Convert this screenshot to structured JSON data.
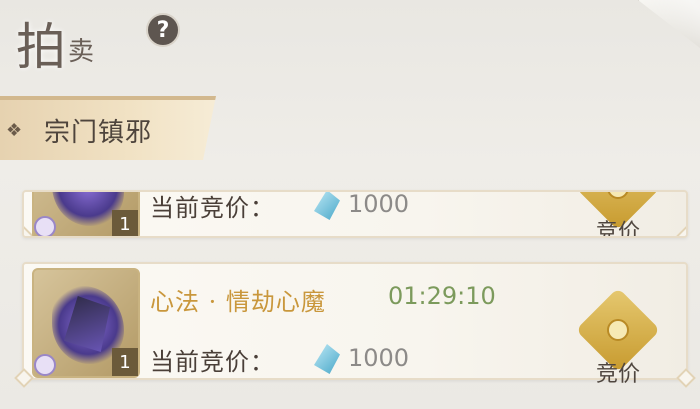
{
  "header": {
    "title_big": "拍",
    "title_small": "卖",
    "help_symbol": "?"
  },
  "category": {
    "label": "宗门镇邪"
  },
  "auctions": [
    {
      "item_count": "1",
      "price_label": "当前竞价：",
      "price_value": "1000",
      "bid_label": "竞价",
      "currency_icon": "gem-icon"
    },
    {
      "name": "心法 · 情劫心魔",
      "timer": "01:29:10",
      "item_count": "1",
      "price_label": "当前竞价：",
      "price_value": "1000",
      "bid_label": "竞价",
      "currency_icon": "gem-icon"
    }
  ],
  "colors": {
    "item_name": "#c9973c",
    "timer": "#7c9a5c",
    "bid_emblem": "#d8b04a"
  }
}
